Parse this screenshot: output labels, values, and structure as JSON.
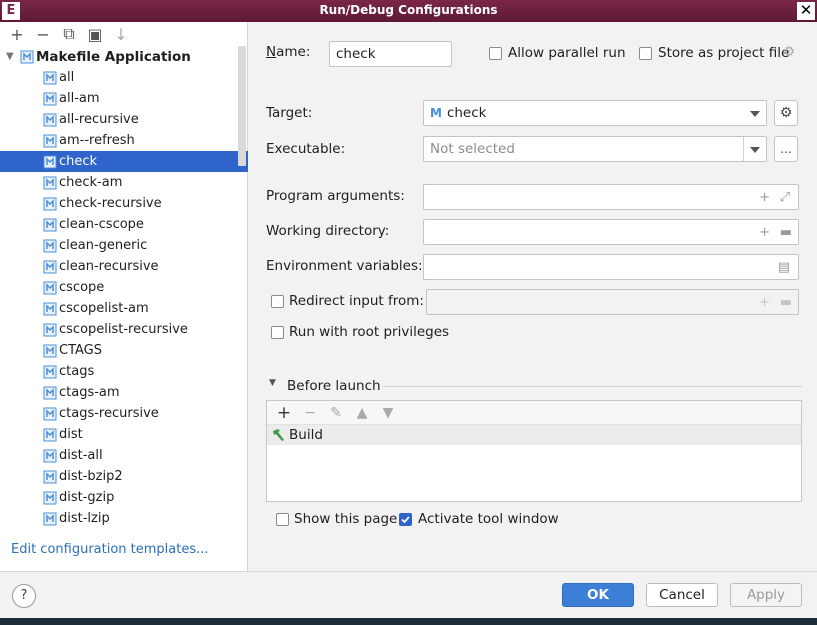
{
  "window": {
    "title": "Run/Debug Configurations",
    "app_icon_letter": "E",
    "close_glyph": "✕"
  },
  "toolbar": {
    "add": "+",
    "remove": "−",
    "copy": "⧉",
    "folder": "▣",
    "sort": "↓"
  },
  "tree": {
    "root_label": "Makefile Application",
    "items": [
      {
        "label": "all"
      },
      {
        "label": "all-am"
      },
      {
        "label": "all-recursive"
      },
      {
        "label": "am--refresh"
      },
      {
        "label": "check"
      },
      {
        "label": "check-am"
      },
      {
        "label": "check-recursive"
      },
      {
        "label": "clean-cscope"
      },
      {
        "label": "clean-generic"
      },
      {
        "label": "clean-recursive"
      },
      {
        "label": "cscope"
      },
      {
        "label": "cscopelist-am"
      },
      {
        "label": "cscopelist-recursive"
      },
      {
        "label": "CTAGS"
      },
      {
        "label": "ctags"
      },
      {
        "label": "ctags-am"
      },
      {
        "label": "ctags-recursive"
      },
      {
        "label": "dist"
      },
      {
        "label": "dist-all"
      },
      {
        "label": "dist-bzip2"
      },
      {
        "label": "dist-gzip"
      },
      {
        "label": "dist-lzip"
      }
    ],
    "selected": "check"
  },
  "edit_templates_link": "Edit configuration templates...",
  "form": {
    "name_label": "Name:",
    "name_value": "check",
    "allow_parallel_label": "Allow parallel run",
    "store_project_label": "Store as project file",
    "target_label": "Target:",
    "target_value": "check",
    "executable_label": "Executable:",
    "executable_placeholder": "Not selected",
    "browse_label": "...",
    "program_args_label": "Program arguments:",
    "working_dir_label": "Working directory:",
    "env_vars_label": "Environment variables:",
    "redirect_label": "Redirect input from:",
    "root_priv_label": "Run with root privileges"
  },
  "before_launch": {
    "title": "Before launch",
    "tasks": [
      {
        "label": "Build"
      }
    ]
  },
  "show_page_label": "Show this page",
  "activate_tool_label": "Activate tool window",
  "buttons": {
    "help": "?",
    "ok": "OK",
    "cancel": "Cancel",
    "apply": "Apply"
  },
  "colors": {
    "titlebar": "#6e2040",
    "selection": "#2f65ca",
    "primary_button": "#3d7fd6",
    "link": "#2a6fb8"
  }
}
